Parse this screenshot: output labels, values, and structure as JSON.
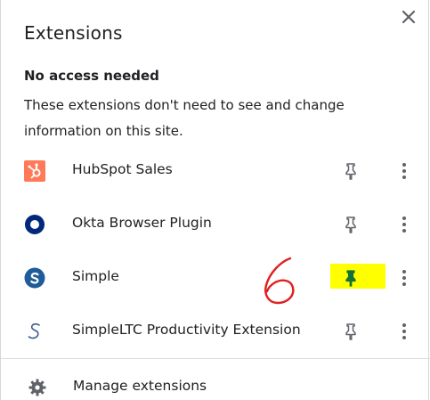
{
  "popup": {
    "title": "Extensions",
    "close_icon": "close-icon"
  },
  "no_access": {
    "heading": "No access needed",
    "description": "These extensions don't need to see and change information on this site."
  },
  "extensions": [
    {
      "name": "HubSpot Sales",
      "icon": "hubspot-icon",
      "pinned": false,
      "icon_color": "#ff7a59"
    },
    {
      "name": "Okta Browser Plugin",
      "icon": "okta-icon",
      "pinned": false,
      "icon_color": "#00297a"
    },
    {
      "name": "Simple",
      "icon": "simple-icon",
      "pinned": true,
      "icon_color": "#1f5c99"
    },
    {
      "name": "SimpleLTC Productivity Extension",
      "icon": "simpleltc-icon",
      "pinned": false,
      "icon_color": "#3a5a8c"
    }
  ],
  "annotation": {
    "text": "6",
    "color": "#e02020",
    "highlight_color": "#ffff00"
  },
  "footer": {
    "manage_label": "Manage extensions",
    "manage_icon": "gear-icon"
  },
  "colors": {
    "text": "#202124",
    "icon_grey": "#5f6368",
    "pinned_green": "#137333"
  }
}
